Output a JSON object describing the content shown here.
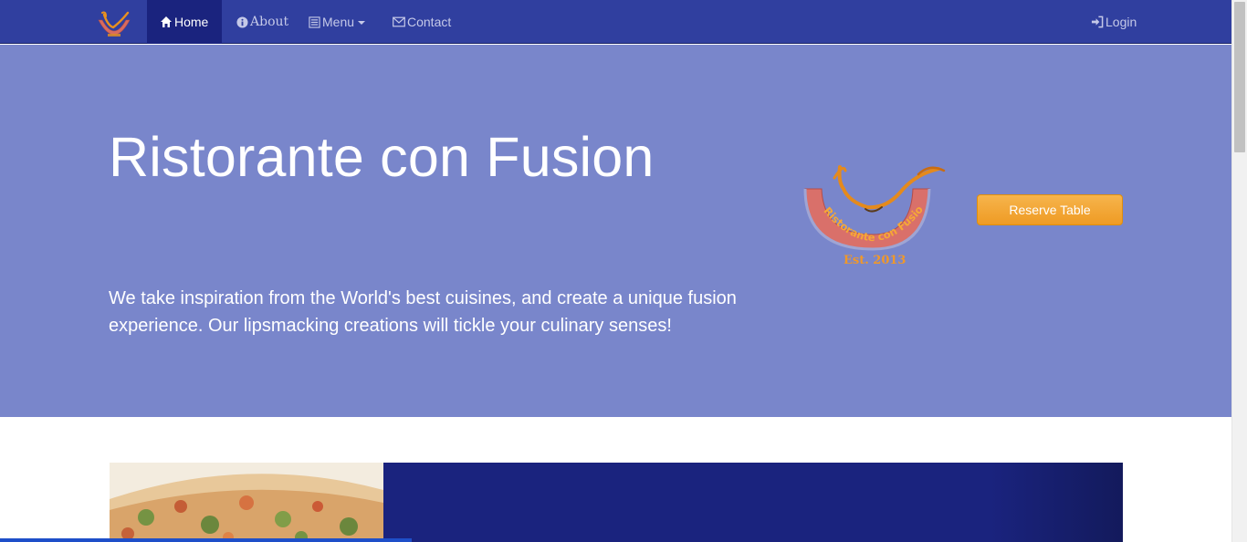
{
  "navbar": {
    "items": [
      {
        "label": "Home",
        "icon": "home-icon"
      },
      {
        "label": "About",
        "icon": "info-circle-icon"
      },
      {
        "label": "Menu",
        "icon": "list-icon"
      },
      {
        "label": "Contact",
        "icon": "envelope-icon"
      }
    ],
    "login": {
      "label": "Login",
      "icon": "sign-in-icon"
    }
  },
  "jumbotron": {
    "title": "Ristorante con Fusion",
    "description": "We take inspiration from the World's best cuisines, and create a unique fusion experience. Our lipsmacking creations will tickle your culinary senses!",
    "reserve_label": "Reserve Table"
  },
  "logo": {
    "text": "Ristorante con Fusion",
    "established": "Est. 2013"
  },
  "colors": {
    "navbar": "#303F9F",
    "navbar_active": "#1A237E",
    "jumbotron": "#7986CB",
    "accent_button": "#EF9B24",
    "dark_panel": "#1A237E"
  },
  "progress": {
    "fraction": 0.33
  }
}
